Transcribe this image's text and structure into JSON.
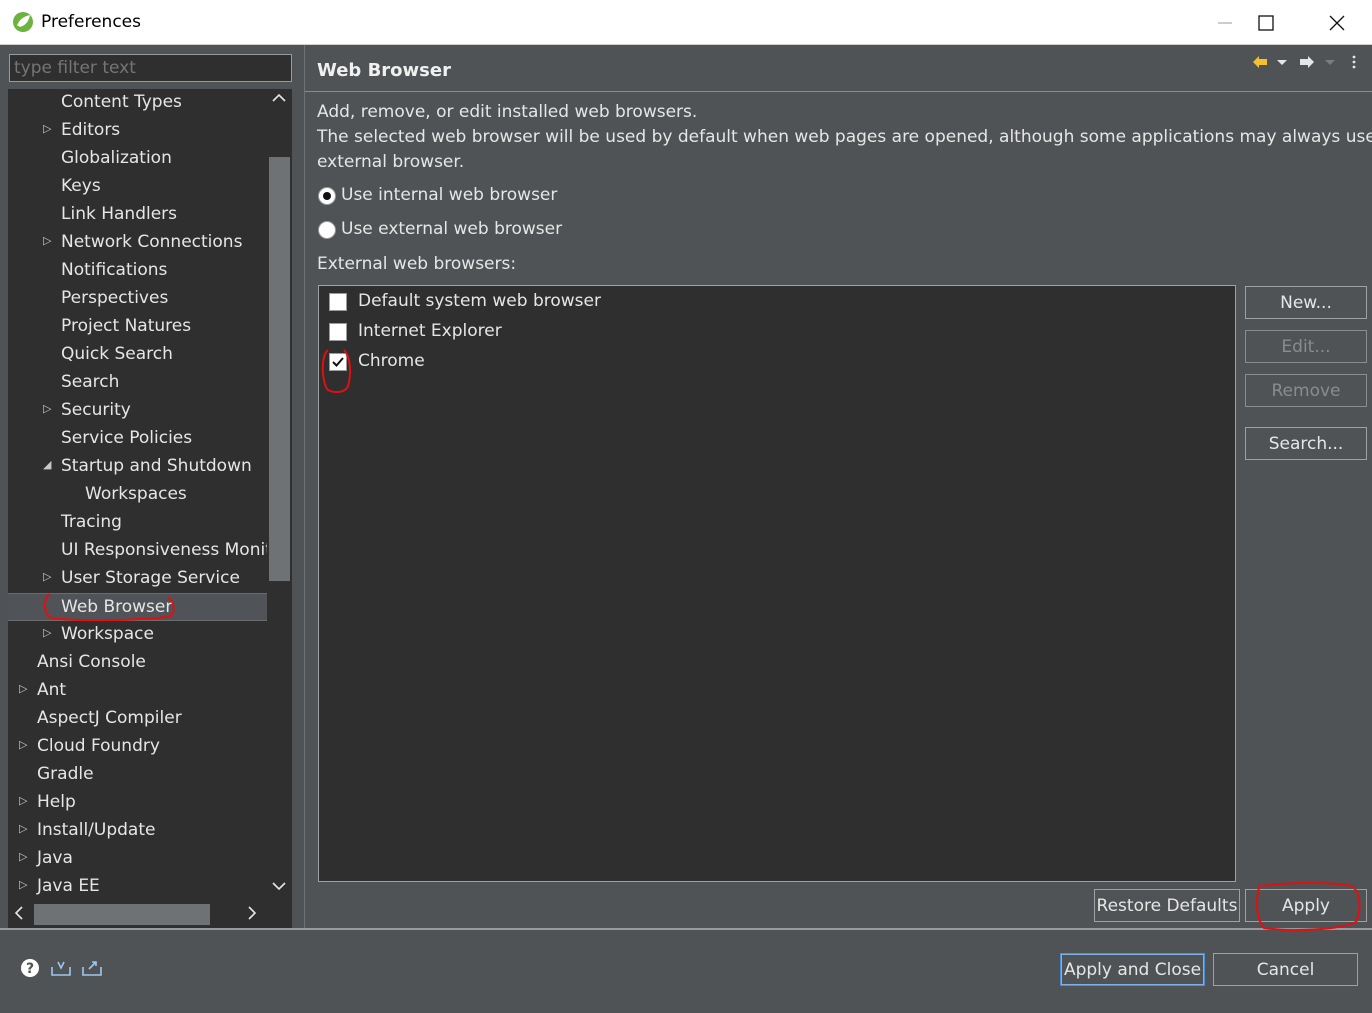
{
  "window": {
    "title": "Preferences",
    "controls": {
      "minimize": "—",
      "maximize": "☐",
      "close": "✕"
    }
  },
  "filter": {
    "placeholder": "type filter text"
  },
  "tree": {
    "items": [
      {
        "label": "Content Types",
        "level": 1,
        "expandable": false
      },
      {
        "label": "Editors",
        "level": 1,
        "expandable": true
      },
      {
        "label": "Globalization",
        "level": 1,
        "expandable": false
      },
      {
        "label": "Keys",
        "level": 1,
        "expandable": false
      },
      {
        "label": "Link Handlers",
        "level": 1,
        "expandable": false
      },
      {
        "label": "Network Connections",
        "level": 1,
        "expandable": true
      },
      {
        "label": "Notifications",
        "level": 1,
        "expandable": false
      },
      {
        "label": "Perspectives",
        "level": 1,
        "expandable": false
      },
      {
        "label": "Project Natures",
        "level": 1,
        "expandable": false
      },
      {
        "label": "Quick Search",
        "level": 1,
        "expandable": false
      },
      {
        "label": "Search",
        "level": 1,
        "expandable": false
      },
      {
        "label": "Security",
        "level": 1,
        "expandable": true
      },
      {
        "label": "Service Policies",
        "level": 1,
        "expandable": false
      },
      {
        "label": "Startup and Shutdown",
        "level": 1,
        "expandable": true,
        "expanded": true
      },
      {
        "label": "Workspaces",
        "level": 2,
        "expandable": false
      },
      {
        "label": "Tracing",
        "level": 1,
        "expandable": false
      },
      {
        "label": "UI Responsiveness Monit",
        "level": 1,
        "expandable": false
      },
      {
        "label": "User Storage Service",
        "level": 1,
        "expandable": true
      },
      {
        "label": "Web Browser",
        "level": 1,
        "expandable": false,
        "selected": true
      },
      {
        "label": "Workspace",
        "level": 1,
        "expandable": true
      },
      {
        "label": "Ansi Console",
        "level": 0,
        "expandable": false
      },
      {
        "label": "Ant",
        "level": 0,
        "expandable": true
      },
      {
        "label": "AspectJ Compiler",
        "level": 0,
        "expandable": false
      },
      {
        "label": "Cloud Foundry",
        "level": 0,
        "expandable": true
      },
      {
        "label": "Gradle",
        "level": 0,
        "expandable": false
      },
      {
        "label": "Help",
        "level": 0,
        "expandable": true
      },
      {
        "label": "Install/Update",
        "level": 0,
        "expandable": true
      },
      {
        "label": "Java",
        "level": 0,
        "expandable": true
      },
      {
        "label": "Java EE",
        "level": 0,
        "expandable": true
      }
    ]
  },
  "page": {
    "title": "Web Browser",
    "description_line1": "Add, remove, or edit installed web browsers.",
    "description_line2": "The selected web browser will be used by default when web pages are opened, although some applications may always use the",
    "description_line3": "external browser.",
    "radio_internal": {
      "label": "Use internal web browser",
      "checked": true
    },
    "radio_external": {
      "label": "Use external web browser",
      "checked": false
    },
    "list_label": "External web browsers:",
    "browsers": [
      {
        "label": "Default system web browser",
        "checked": false
      },
      {
        "label": "Internet Explorer",
        "checked": false
      },
      {
        "label": "Chrome",
        "checked": true
      }
    ],
    "buttons": {
      "new": "New...",
      "edit": "Edit...",
      "remove": "Remove",
      "search": "Search...",
      "restore_defaults": "Restore Defaults",
      "apply": "Apply"
    }
  },
  "footer": {
    "apply_and_close": "Apply and Close",
    "cancel": "Cancel"
  },
  "colors": {
    "background": "#4f5355",
    "panel": "#2f2f2f",
    "text": "#e6e6e6",
    "annotation": "#e01010",
    "default_button_border": "#4a90d9"
  },
  "icons": [
    "spring-logo-icon",
    "back-arrow-icon",
    "forward-arrow-icon",
    "view-menu-icon",
    "help-icon",
    "import-icon",
    "export-icon",
    "checkmark-icon"
  ]
}
